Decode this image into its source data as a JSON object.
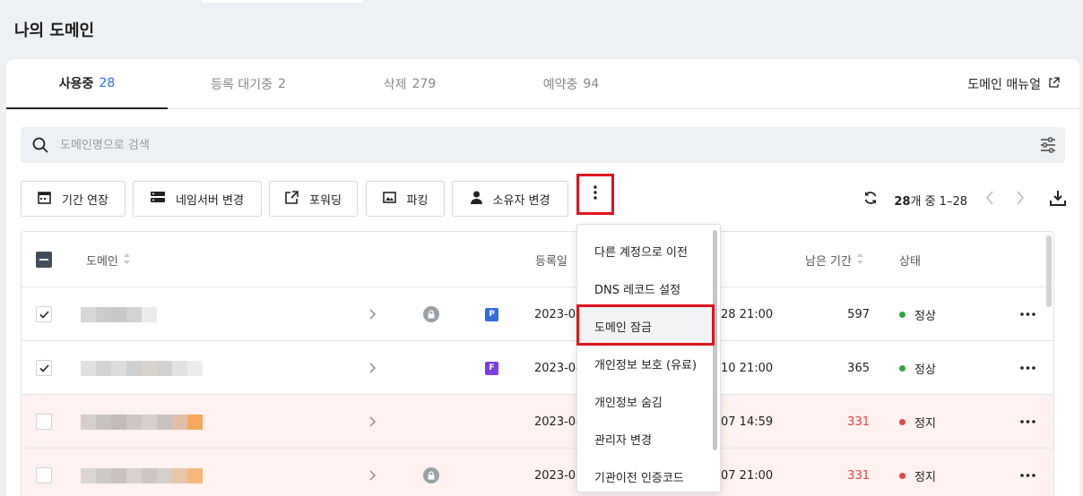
{
  "page": {
    "title": "나의 도메인"
  },
  "tabs": [
    {
      "label": "사용중",
      "count": "28"
    },
    {
      "label": "등록 대기중",
      "count": "2"
    },
    {
      "label": "삭제",
      "count": "279"
    },
    {
      "label": "예약중",
      "count": "94"
    }
  ],
  "manual": {
    "label": "도메인 매뉴얼"
  },
  "search": {
    "placeholder": "도메인명으로 검색"
  },
  "toolbar": {
    "extend": "기간 연장",
    "nameserver": "네임서버 변경",
    "forwarding": "포워딩",
    "parking": "파킹",
    "owner": "소유자 변경"
  },
  "pager": {
    "total": "28",
    "suffix": "개 중 1–28"
  },
  "table": {
    "headers": {
      "domain": "도메인",
      "registered": "등록일",
      "remaining": "남은 기간",
      "status": "상태"
    },
    "rows": [
      {
        "date": "2023-04",
        "expiry": "28 21:00",
        "days": "597",
        "status": "정상",
        "badge": "P"
      },
      {
        "date": "2023-04",
        "expiry": "10 21:00",
        "days": "365",
        "status": "정상",
        "badge": "F"
      },
      {
        "date": "2023-04",
        "expiry": "07 14:59",
        "days": "331",
        "status": "정지",
        "badge": ""
      },
      {
        "date": "2023-03",
        "expiry": "07 21:00",
        "days": "331",
        "status": "정지",
        "badge": ""
      }
    ]
  },
  "dropdown": {
    "items": [
      "다른 계정으로 이전",
      "DNS 레코드 설정",
      "도메인 잠금",
      "개인정보 보호 (유료)",
      "개인정보 숨김",
      "관리자 변경",
      "기관이전 인증코드"
    ]
  },
  "colors": {
    "accent": "#2f6de1",
    "highlight_box": "#e0141c",
    "ok": "#2fa53a",
    "stop": "#e64545",
    "stopped_row": "#fff2f1"
  }
}
